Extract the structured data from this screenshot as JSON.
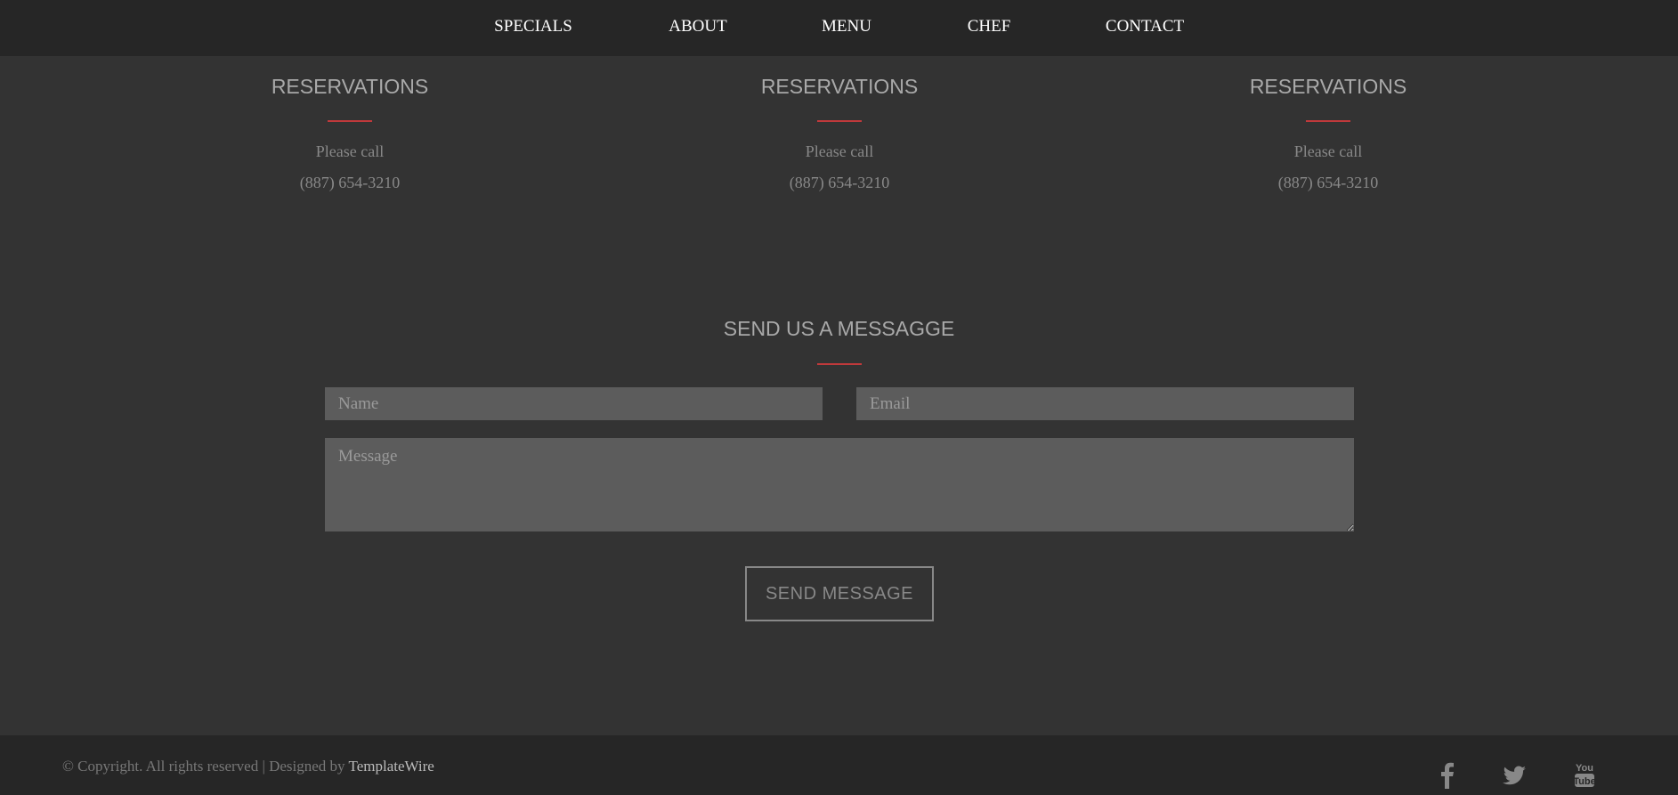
{
  "nav": {
    "items": [
      "SPECIALS",
      "ABOUT",
      "MENU",
      "CHEF",
      "CONTACT"
    ]
  },
  "reservations": [
    {
      "title": "RESERVATIONS",
      "line1": "Please call",
      "phone": "(887) 654-3210"
    },
    {
      "title": "RESERVATIONS",
      "line1": "Please call",
      "phone": "(887) 654-3210"
    },
    {
      "title": "RESERVATIONS",
      "line1": "Please call",
      "phone": "(887) 654-3210"
    }
  ],
  "contact": {
    "title": "SEND US A MESSAGGE",
    "name_placeholder": "Name",
    "email_placeholder": "Email",
    "message_placeholder": "Message",
    "button": "SEND MESSAGE"
  },
  "footer": {
    "copyright": "© Copyright. All rights reserved | Designed by ",
    "designer": "TemplateWire",
    "social": [
      "facebook-icon",
      "twitter-icon",
      "youtube-icon"
    ]
  },
  "colors": {
    "accent": "#c0393b",
    "nav_bg": "#262626",
    "page_bg": "#333333",
    "input_bg": "#5c5c5c"
  }
}
